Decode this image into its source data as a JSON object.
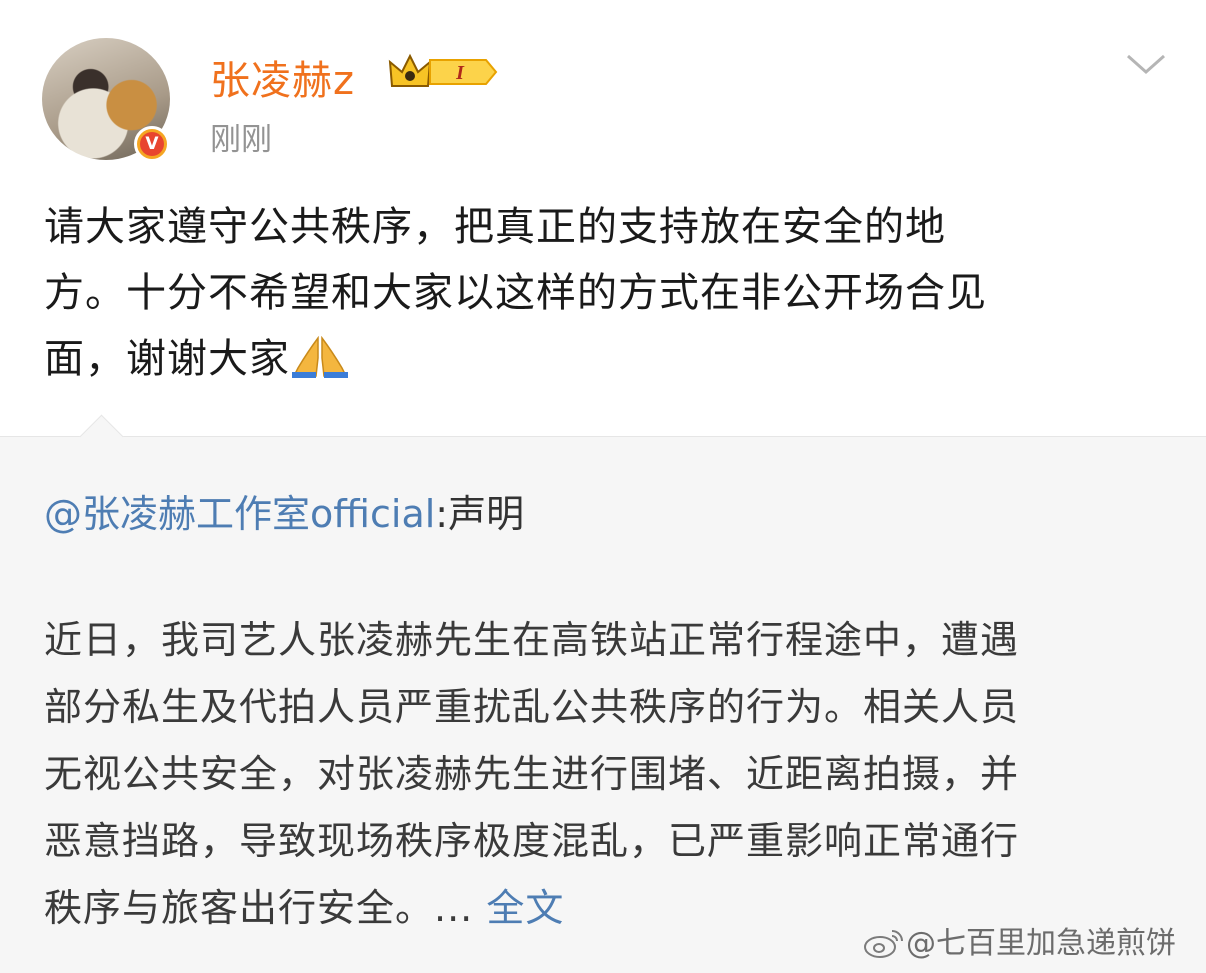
{
  "post": {
    "username": "张凌赫z",
    "level_badge": "I",
    "time": "刚刚",
    "text_lines": [
      "请大家遵守公共秩序，把真正的支持放在安全的地",
      "方。十分不希望和大家以这样的方式在非公开场合见",
      "面，谢谢大家"
    ]
  },
  "repost": {
    "mention": "@张凌赫工作室official",
    "separator": ":",
    "title": "声明",
    "body_lines": [
      "近日，我司艺人张凌赫先生在高铁站正常行程途中，遭遇",
      "部分私生及代拍人员严重扰乱公共秩序的行为。相关人员",
      "无视公共安全，对张凌赫先生进行围堵、近距离拍摄，并",
      "恶意挡路，导致现场秩序极度混乱，已严重影响正常通行",
      "秩序与旅客出行安全。..."
    ],
    "full_text_link": "全文"
  },
  "watermark": "@七百里加急递煎饼",
  "colors": {
    "username": "#f0711d",
    "link": "#4e7db3",
    "time": "#939393",
    "repost_bg": "#f6f6f6"
  },
  "icons": [
    "avatar",
    "verified-v-icon",
    "crown-level-icon",
    "chevron-down-icon",
    "praying-hands-icon",
    "weibo-logo-icon"
  ]
}
